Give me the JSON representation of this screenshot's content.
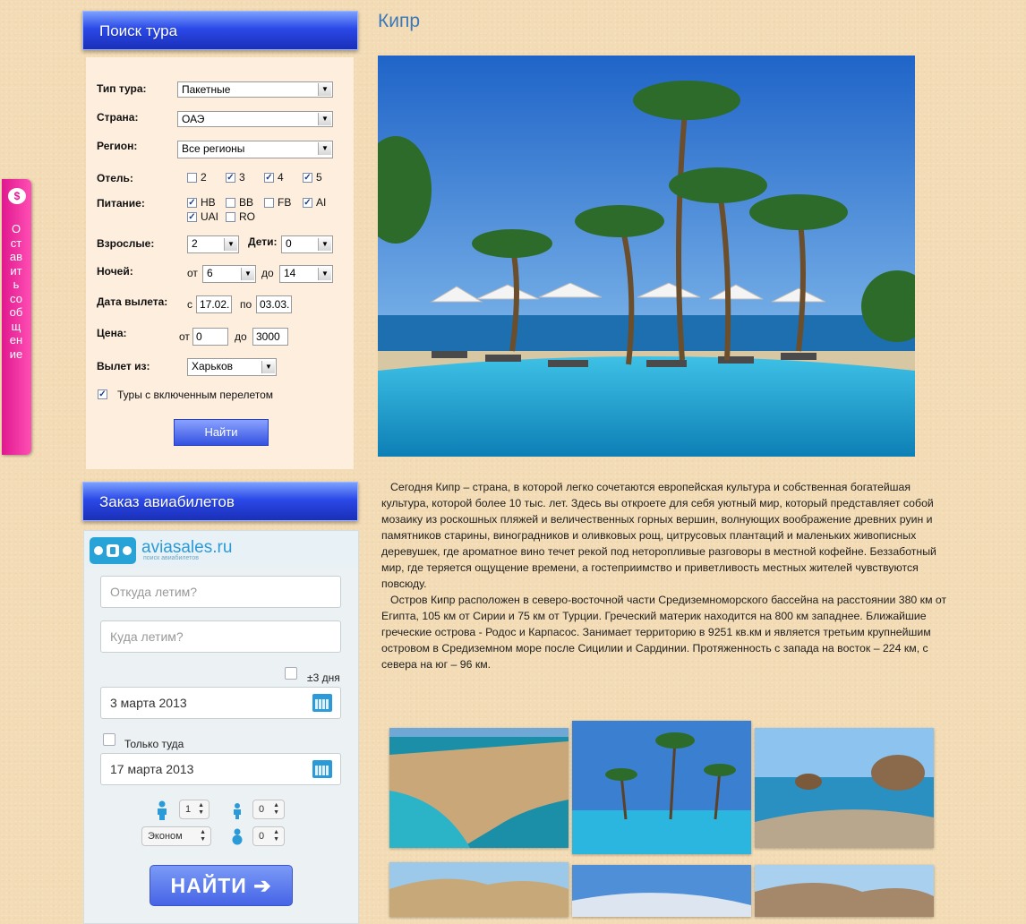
{
  "side_tab": {
    "icon": "$",
    "label": "Оставить сообщение"
  },
  "tour_search": {
    "title": "Поиск тура",
    "tour_type": {
      "label": "Тип тура:",
      "value": "Пакетные"
    },
    "country": {
      "label": "Страна:",
      "value": "ОАЭ"
    },
    "region": {
      "label": "Регион:",
      "value": "Все регионы"
    },
    "hotel": {
      "label": "Отель:",
      "options": [
        {
          "text": "2",
          "checked": false
        },
        {
          "text": "3",
          "checked": true
        },
        {
          "text": "4",
          "checked": true
        },
        {
          "text": "5",
          "checked": true
        }
      ]
    },
    "meals": {
      "label": "Питание:",
      "options": [
        {
          "text": "HB",
          "checked": true
        },
        {
          "text": "BB",
          "checked": false
        },
        {
          "text": "FB",
          "checked": false
        },
        {
          "text": "AI",
          "checked": true
        },
        {
          "text": "UAI",
          "checked": true
        },
        {
          "text": "RO",
          "checked": false
        }
      ]
    },
    "adults": {
      "label": "Взрослые:",
      "value": "2"
    },
    "children": {
      "label": "Дети:",
      "value": "0"
    },
    "nights": {
      "label": "Ночей:",
      "from_label": "от",
      "from": "6",
      "to_label": "до",
      "to": "14"
    },
    "departure_date": {
      "label": "Дата вылета:",
      "from_label": "с",
      "from": "17.02.",
      "to_label": "по",
      "to": "03.03."
    },
    "price": {
      "label": "Цена:",
      "from_label": "от",
      "from": "0",
      "to_label": "до",
      "to": "3000"
    },
    "departure_city": {
      "label": "Вылет из:",
      "value": "Харьков"
    },
    "with_flight": {
      "label": "Туры с включенным перелетом",
      "checked": true
    },
    "submit": "Найти"
  },
  "avia": {
    "title": "Заказ авиабилетов",
    "logo_text": "aviasales.ru",
    "logo_sub": "поиск авиабилетов",
    "from_placeholder": "Откуда летим?",
    "to_placeholder": "Куда летим?",
    "flex_label": "±3 дня",
    "depart_date": "3 марта 2013",
    "oneway_label": "Только туда",
    "return_date": "17 марта 2013",
    "adults": "1",
    "children": "0",
    "infants": "0",
    "class": "Эконом",
    "submit": "НАЙТИ ➔"
  },
  "main": {
    "title": "Кипр",
    "paragraphs": [
      "Сегодня Кипр – страна, в которой легко сочетаются европейская культура и собственная богатейшая культура, которой более 10 тыс. лет. Здесь вы откроете для себя уютный мир, который представляет собой мозаику из роскошных пляжей и величественных горных вершин, волнующих воображение древних руин и памятников старины, виноградников и оливковых рощ, цитрусовых плантаций и маленьких живописных деревушек, где ароматное вино течет рекой под неторопливые разговоры в местной кофейне. Беззаботный мир, где теряется ощущение времени, а гостеприимство и приветливость местных жителей чувствуются повсюду.",
      "Остров Кипр расположен в северо-восточной части Средиземноморского бассейна на расстоянии 380 км от Египта, 105 км от Сирии и 75 км от Турции. Греческий материк находится на 800 км западнее. Ближайшие греческие острова - Родос и Карпасос. Занимает территорию в 9251 кв.км и является третьим крупнейшим островом в Средиземном море после Сицилии и Сардинии. Протяженность с запада на восток – 224 км, с севера на юг – 96 км."
    ]
  }
}
